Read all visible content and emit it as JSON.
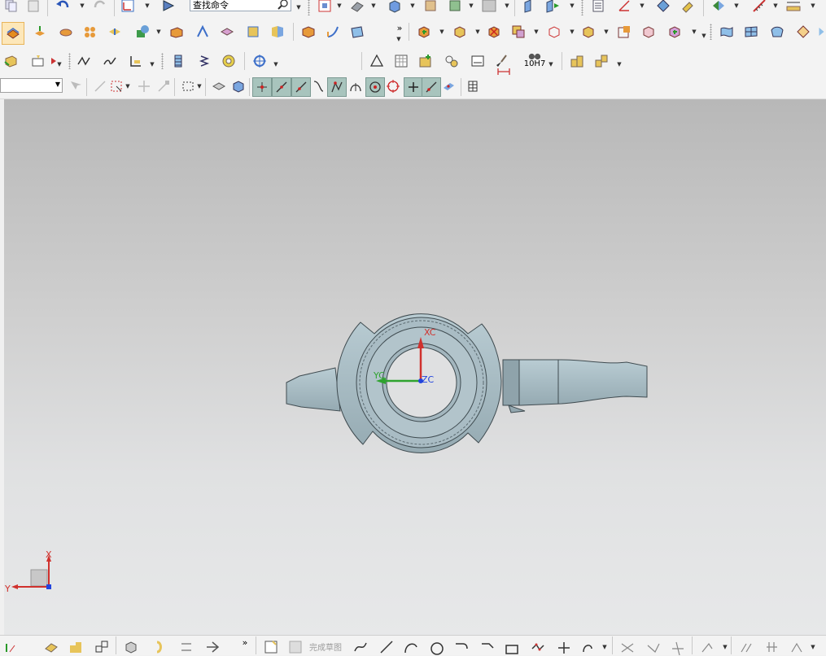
{
  "search": {
    "placeholder": "查找命令"
  },
  "sketch": {
    "finish_label": "完成草图"
  },
  "wcs": {
    "xc": "XC",
    "yc": "YC",
    "zc": "ZC"
  },
  "triad": {
    "x": "X",
    "y": "Y"
  },
  "fit_tolerance": {
    "label": "10H7"
  },
  "colors": {
    "part": "#a9bcc4",
    "part_edge": "#3f4b50",
    "x_axis": "#d0312d",
    "y_axis": "#2fa32f",
    "z_axis": "#2244dd",
    "viewport_top": "#b8b8b8",
    "viewport_bottom": "#e7e8e9"
  }
}
